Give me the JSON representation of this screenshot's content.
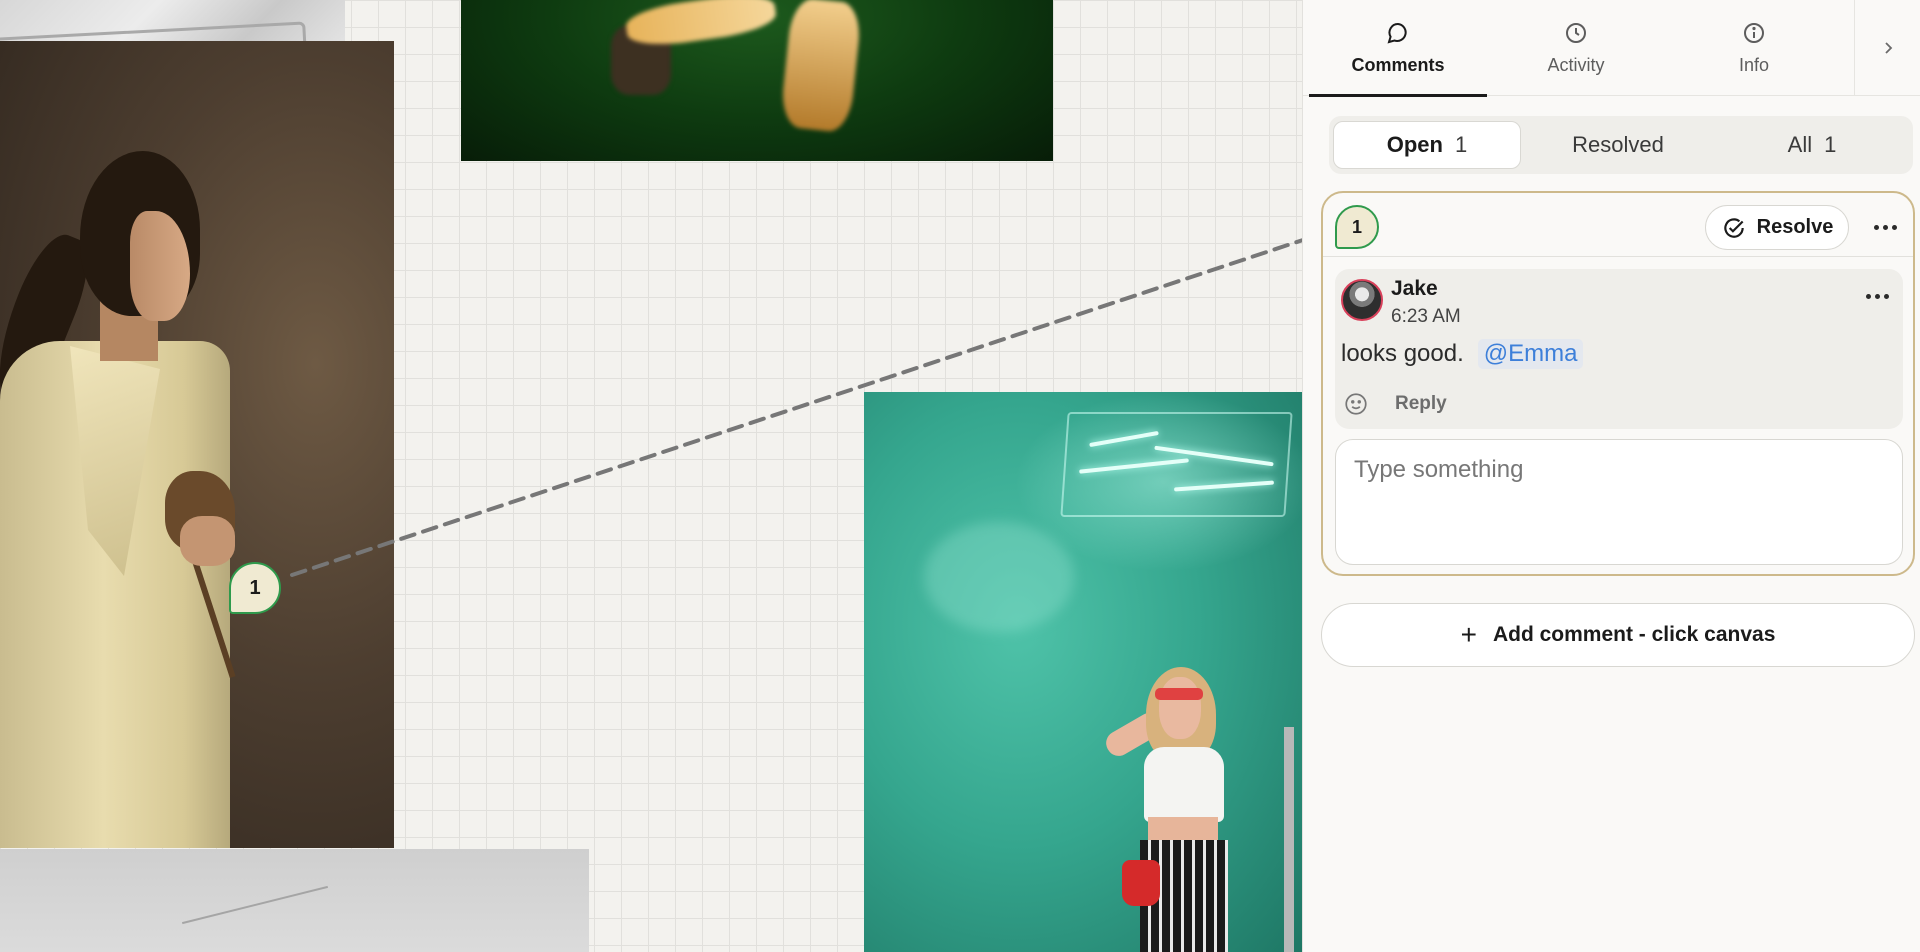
{
  "canvas": {
    "pin_number": "1"
  },
  "panel": {
    "tabs": [
      {
        "label": "Comments",
        "icon": "comment-bubble-icon",
        "active": true
      },
      {
        "label": "Activity",
        "icon": "clock-icon",
        "active": false
      },
      {
        "label": "Info",
        "icon": "info-icon",
        "active": false
      }
    ],
    "expand_icon": "chevron-right-icon",
    "filters": [
      {
        "label": "Open",
        "count": "1",
        "active": true
      },
      {
        "label": "Resolved",
        "count": "",
        "active": false
      },
      {
        "label": "All",
        "count": "1",
        "active": false
      }
    ],
    "thread": {
      "pin_number": "1",
      "resolve_label": "Resolve",
      "comment": {
        "author": "Jake",
        "time": "6:23 AM",
        "text": "looks good.",
        "mention": "@Emma",
        "reply_label": "Reply"
      },
      "reply_placeholder": "Type something"
    },
    "add_comment_label": "Add comment - click canvas"
  },
  "colors": {
    "accent_border": "#cdb98b",
    "pin_green": "#2f9a4c",
    "mention_blue": "#3d7fd9"
  }
}
